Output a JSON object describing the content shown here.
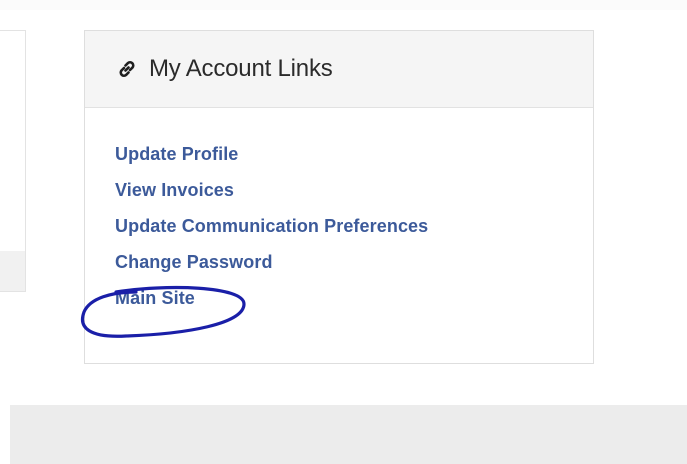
{
  "card": {
    "title": "My Account Links",
    "icon": "link-icon",
    "links": [
      {
        "label": "Update Profile"
      },
      {
        "label": "View Invoices"
      },
      {
        "label": "Update Communication Preferences"
      },
      {
        "label": "Change Password"
      },
      {
        "label": "Main Site"
      }
    ]
  },
  "colors": {
    "link": "#3c5a9a",
    "annotation": "#1a1fa8",
    "header_bg": "#f5f5f5",
    "footer_bg": "#ececec"
  }
}
